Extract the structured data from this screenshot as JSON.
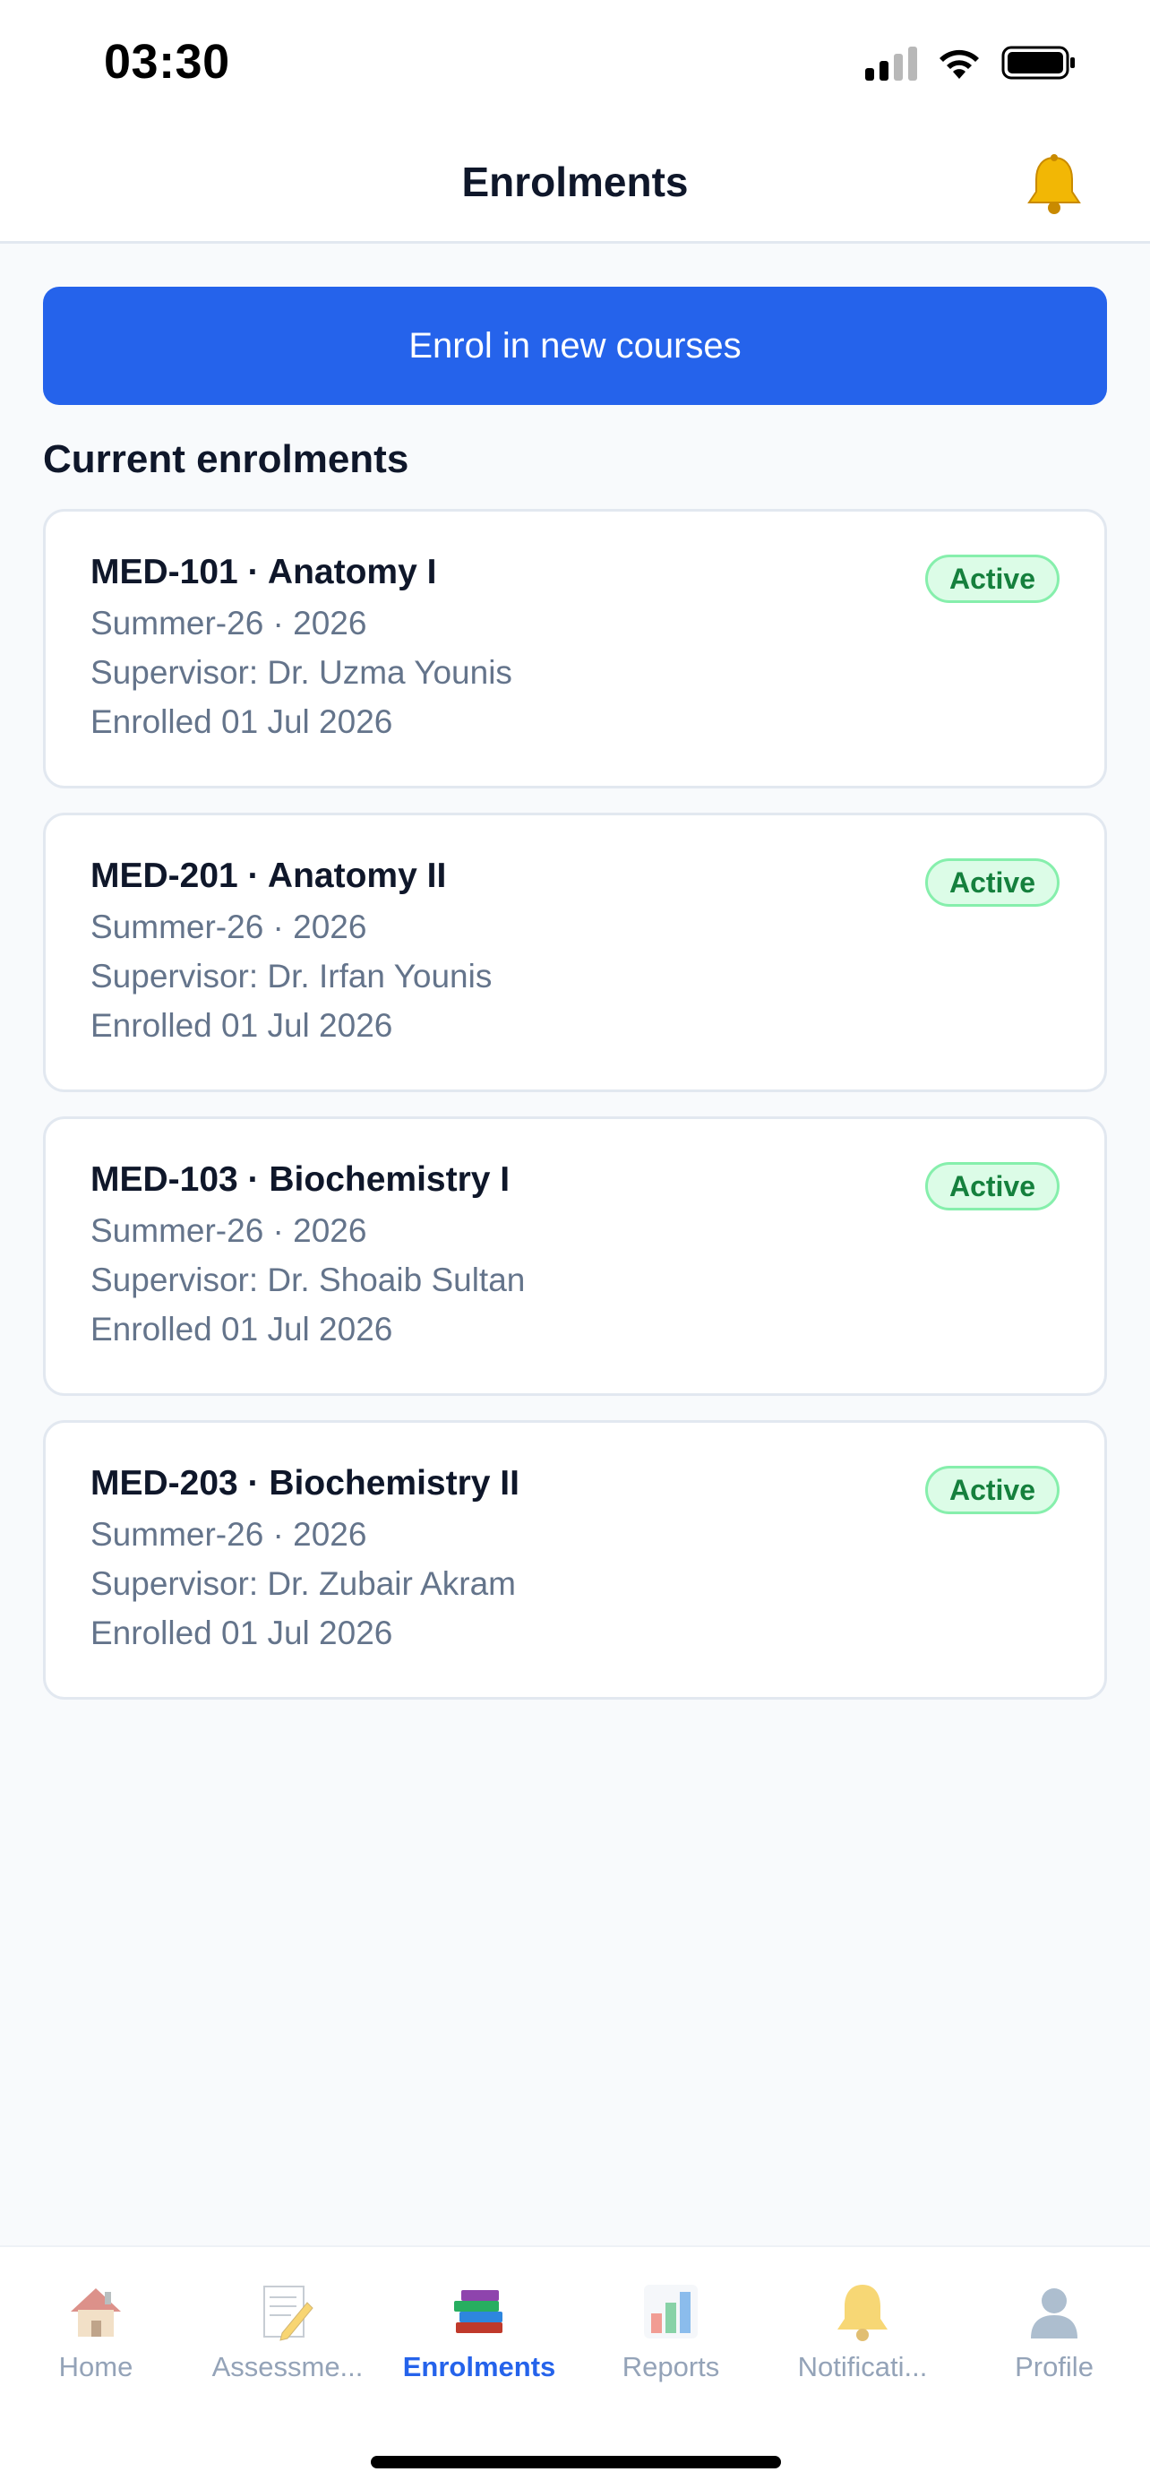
{
  "status_bar": {
    "time": "03:30"
  },
  "header": {
    "title": "Enrolments",
    "bell_icon": "bell-icon"
  },
  "actions": {
    "enrol_button": "Enrol in new courses"
  },
  "section": {
    "title": "Current enrolments"
  },
  "enrolments": [
    {
      "title": "MED-101 · Anatomy I",
      "term": "Summer-26 · 2026",
      "supervisor": "Supervisor: Dr. Uzma Younis",
      "enrolled": "Enrolled 01 Jul 2026",
      "status": "Active"
    },
    {
      "title": "MED-201 · Anatomy II",
      "term": "Summer-26 · 2026",
      "supervisor": "Supervisor: Dr. Irfan Younis",
      "enrolled": "Enrolled 01 Jul 2026",
      "status": "Active"
    },
    {
      "title": "MED-103 · Biochemistry I",
      "term": "Summer-26 · 2026",
      "supervisor": "Supervisor: Dr. Shoaib Sultan",
      "enrolled": "Enrolled 01 Jul 2026",
      "status": "Active"
    },
    {
      "title": "MED-203 · Biochemistry II",
      "term": "Summer-26 · 2026",
      "supervisor": "Supervisor: Dr. Zubair Akram",
      "enrolled": "Enrolled 01 Jul 2026",
      "status": "Active"
    }
  ],
  "tabs": [
    {
      "label": "Home",
      "icon": "house-icon"
    },
    {
      "label": "Assessme...",
      "icon": "memo-icon"
    },
    {
      "label": "Enrolments",
      "icon": "books-icon",
      "active": true
    },
    {
      "label": "Reports",
      "icon": "bar-chart-icon"
    },
    {
      "label": "Notificati...",
      "icon": "bell-icon"
    },
    {
      "label": "Profile",
      "icon": "person-icon"
    }
  ],
  "colors": {
    "accent": "#2563eb",
    "badge_bg": "#dcfce7",
    "badge_text": "#15803d",
    "muted_text": "#64748b"
  }
}
